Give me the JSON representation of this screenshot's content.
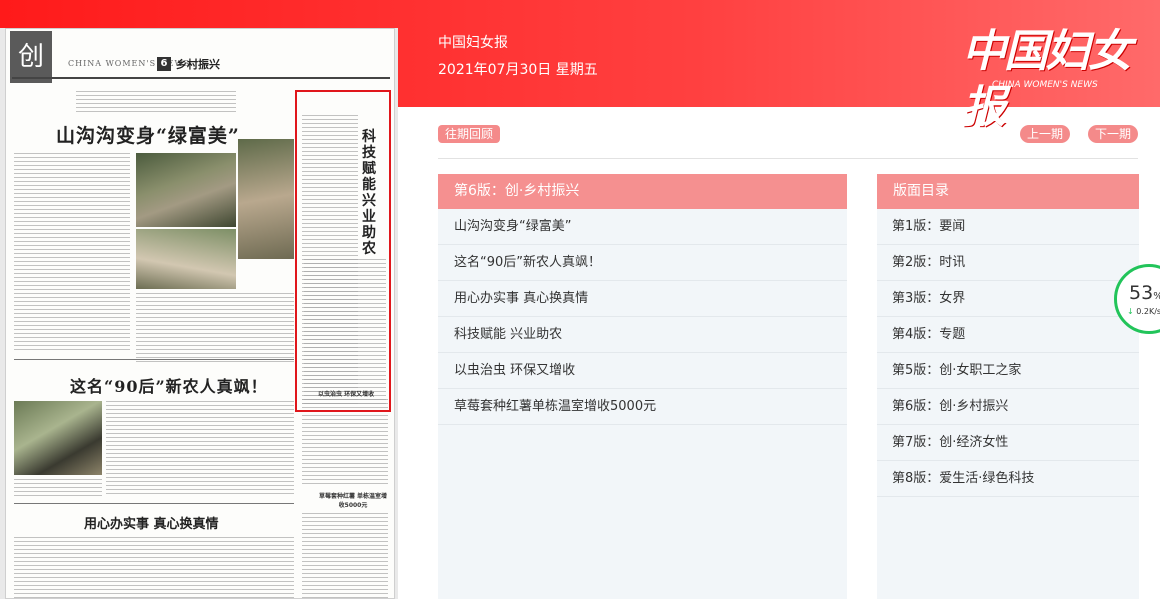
{
  "header": {
    "paper_title": "中国妇女报",
    "date": "2021年07月30日 星期五",
    "logo_text": "中国妇女报",
    "logo_en": "CHINA WOMEN'S NEWS"
  },
  "toolbar": {
    "history_label": "往期回顾",
    "prev_label": "上一期",
    "next_label": "下一期"
  },
  "articles_panel": {
    "title": "第6版：创·乡村振兴",
    "items": [
      "山沟沟变身“绿富美”",
      "这名“90后”新农人真飒！",
      "用心办实事 真心换真情",
      "科技赋能 兴业助农",
      "以虫治虫 环保又增收",
      "草莓套种红薯单栋温室增收5000元"
    ]
  },
  "pages_panel": {
    "title": "版面目录",
    "items": [
      "第1版：要闻",
      "第2版：时讯",
      "第3版：女界",
      "第4版：专题",
      "第5版：创·女职工之家",
      "第6版：创·乡村振兴",
      "第7版：创·经济女性",
      "第8版：爱生活·绿色科技"
    ]
  },
  "paper_page": {
    "masthead_en": "CHINA WOMEN'S NEWS",
    "page_no": "6",
    "section": "乡村振兴",
    "chuang": "创",
    "headline_1": "山沟沟变身“绿富美”",
    "headline_2": "这名“90后”新农人真飒！",
    "headline_3": "用心办实事 真心换真情",
    "headline_4": "以虫治虫 环保又增收",
    "headline_5": "草莓套种红薯 单栋温室增收5000元",
    "vertical_headline": "科技赋能 兴业助农"
  },
  "speed_widget": {
    "percent": "53",
    "percent_unit": "%",
    "rate": "0.2K/s"
  },
  "colors": {
    "brand_red": "#ff1a1a",
    "panel_head": "#f59090",
    "badge": "#f48a8a",
    "panel_bg": "#f2f6f9",
    "highlight": "#e0161b"
  }
}
